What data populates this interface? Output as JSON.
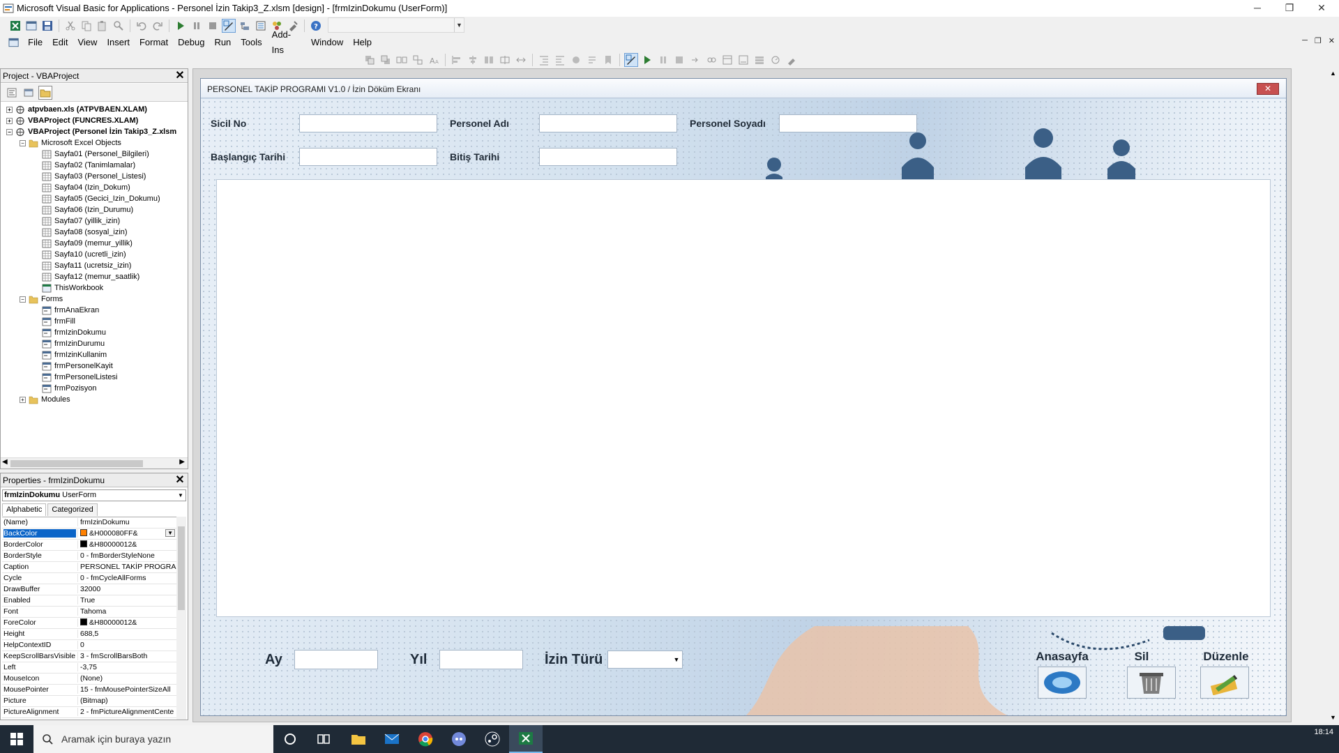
{
  "window": {
    "title": "Microsoft Visual Basic for Applications - Personel İzin Takip3_Z.xlsm [design] - [frmIzinDokumu (UserForm)]",
    "minimize": "─",
    "restore": "❐",
    "close": "✕"
  },
  "menu": [
    "File",
    "Edit",
    "View",
    "Insert",
    "Format",
    "Debug",
    "Run",
    "Tools",
    "Add-Ins",
    "Window",
    "Help"
  ],
  "mdi_controls": {
    "minimize": "─",
    "restore": "❐",
    "close": "✕"
  },
  "project_panel": {
    "title": "Project - VBAProject",
    "close": "✕",
    "tree": [
      {
        "label": "atpvbaen.xls (ATPVBAEN.XLAM)",
        "level": 0,
        "bold": true,
        "toggle": "+",
        "icon": "vba-project-icon"
      },
      {
        "label": "VBAProject (FUNCRES.XLAM)",
        "level": 0,
        "bold": true,
        "toggle": "+",
        "icon": "vba-project-icon"
      },
      {
        "label": "VBAProject (Personel İzin Takip3_Z.xlsm",
        "level": 0,
        "bold": true,
        "toggle": "−",
        "icon": "vba-project-icon"
      },
      {
        "label": "Microsoft Excel Objects",
        "level": 1,
        "toggle": "−",
        "icon": "folder-icon"
      },
      {
        "label": "Sayfa01 (Personel_Bilgileri)",
        "level": 2,
        "icon": "sheet-icon"
      },
      {
        "label": "Sayfa02 (Tanimlamalar)",
        "level": 2,
        "icon": "sheet-icon"
      },
      {
        "label": "Sayfa03 (Personel_Listesi)",
        "level": 2,
        "icon": "sheet-icon"
      },
      {
        "label": "Sayfa04 (Izin_Dokum)",
        "level": 2,
        "icon": "sheet-icon"
      },
      {
        "label": "Sayfa05 (Gecici_Izin_Dokumu)",
        "level": 2,
        "icon": "sheet-icon"
      },
      {
        "label": "Sayfa06 (Izin_Durumu)",
        "level": 2,
        "icon": "sheet-icon"
      },
      {
        "label": "Sayfa07 (yillik_izin)",
        "level": 2,
        "icon": "sheet-icon"
      },
      {
        "label": "Sayfa08 (sosyal_izin)",
        "level": 2,
        "icon": "sheet-icon"
      },
      {
        "label": "Sayfa09 (memur_yillik)",
        "level": 2,
        "icon": "sheet-icon"
      },
      {
        "label": "Sayfa10 (ucretli_izin)",
        "level": 2,
        "icon": "sheet-icon"
      },
      {
        "label": "Sayfa11 (ucretsiz_izin)",
        "level": 2,
        "icon": "sheet-icon"
      },
      {
        "label": "Sayfa12 (memur_saatlik)",
        "level": 2,
        "icon": "sheet-icon"
      },
      {
        "label": "ThisWorkbook",
        "level": 2,
        "icon": "workbook-icon"
      },
      {
        "label": "Forms",
        "level": 1,
        "toggle": "−",
        "icon": "folder-icon"
      },
      {
        "label": "frmAnaEkran",
        "level": 2,
        "icon": "form-icon"
      },
      {
        "label": "frmFill",
        "level": 2,
        "icon": "form-icon"
      },
      {
        "label": "frmIzinDokumu",
        "level": 2,
        "icon": "form-icon"
      },
      {
        "label": "frmIzinDurumu",
        "level": 2,
        "icon": "form-icon"
      },
      {
        "label": "frmIzinKullanim",
        "level": 2,
        "icon": "form-icon"
      },
      {
        "label": "frmPersonelKayit",
        "level": 2,
        "icon": "form-icon"
      },
      {
        "label": "frmPersonelListesi",
        "level": 2,
        "icon": "form-icon"
      },
      {
        "label": "frmPozisyon",
        "level": 2,
        "icon": "form-icon"
      },
      {
        "label": "Modules",
        "level": 1,
        "toggle": "+",
        "icon": "folder-icon"
      }
    ]
  },
  "properties_panel": {
    "title": "Properties - frmIzinDokumu",
    "close": "✕",
    "object_name": "frmIzinDokumu",
    "object_type": "UserForm",
    "tabs": [
      "Alphabetic",
      "Categorized"
    ],
    "active_tab": "Alphabetic",
    "rows": [
      {
        "name": "(Name)",
        "value": "frmIzinDokumu"
      },
      {
        "name": "BackColor",
        "value": "&H000080FF&",
        "swatch": "#ff8000",
        "selected": true
      },
      {
        "name": "BorderColor",
        "value": "&H80000012&",
        "swatch": "#000000"
      },
      {
        "name": "BorderStyle",
        "value": "0 - fmBorderStyleNone"
      },
      {
        "name": "Caption",
        "value": "PERSONEL TAKİP PROGRAMI"
      },
      {
        "name": "Cycle",
        "value": "0 - fmCycleAllForms"
      },
      {
        "name": "DrawBuffer",
        "value": "32000"
      },
      {
        "name": "Enabled",
        "value": "True"
      },
      {
        "name": "Font",
        "value": "Tahoma"
      },
      {
        "name": "ForeColor",
        "value": "&H80000012&",
        "swatch": "#000000"
      },
      {
        "name": "Height",
        "value": "688,5"
      },
      {
        "name": "HelpContextID",
        "value": "0"
      },
      {
        "name": "KeepScrollBarsVisible",
        "value": "3 - fmScrollBarsBoth"
      },
      {
        "name": "Left",
        "value": "-3,75"
      },
      {
        "name": "MouseIcon",
        "value": "(None)"
      },
      {
        "name": "MousePointer",
        "value": "15 - fmMousePointerSizeAll"
      },
      {
        "name": "Picture",
        "value": "(Bitmap)"
      },
      {
        "name": "PictureAlignment",
        "value": "2 - fmPictureAlignmentCente"
      }
    ]
  },
  "form": {
    "caption": "PERSONEL TAKİP PROGRAMI V1.0 / İzin Döküm Ekranı",
    "close": "✕",
    "labels": {
      "sicil_no": "Sicil No",
      "personel_adi": "Personel Adı",
      "personel_soyadi": "Personel Soyadı",
      "baslangic_tarihi": "Başlangıç Tarihi",
      "bitis_tarihi": "Bitiş Tarihi",
      "ay": "Ay",
      "yil": "Yıl",
      "izin_turu": "İzin Türü"
    },
    "buttons": {
      "anasayfa": "Anasayfa",
      "sil": "Sil",
      "duzenle": "Düzenle"
    }
  },
  "taskbar": {
    "search_placeholder": "Aramak için buraya yazın",
    "clock_time": "18:14"
  },
  "colors": {
    "selection": "#0a64c8",
    "form_close": "#c75050",
    "taskbar": "#1f2a36"
  }
}
